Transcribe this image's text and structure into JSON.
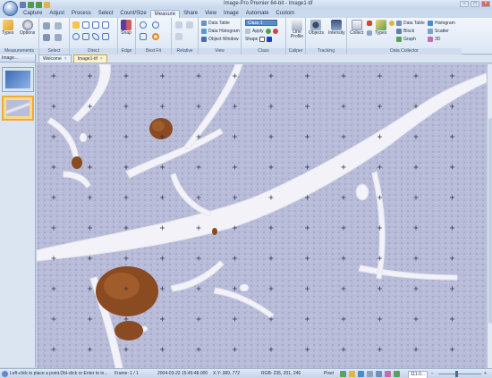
{
  "window": {
    "title": "Image-Pro Premier 64-bit - Image1-tif"
  },
  "menu": {
    "tabs": [
      "Capture",
      "Adjust",
      "Process",
      "Select",
      "Count/Size",
      "Measure",
      "Share",
      "View",
      "Image",
      "Automate",
      "Custom"
    ],
    "active": "Measure"
  },
  "ribbon": {
    "groups": {
      "measurements": "Measurements",
      "select": "Select",
      "direct": "Direct",
      "edge": "Edge",
      "best_fit": "Best Fit",
      "relative": "Relative",
      "view": "View",
      "class": "Class",
      "caliper": "Caliper",
      "tracking": "Tracking",
      "data_collector": "Data Collector"
    },
    "buttons": {
      "types": "Types",
      "options": "Options",
      "snap": "Snap",
      "data_table": "Data Table",
      "data_histogram": "Data Histogram",
      "object_window": "Object Window",
      "apply": "Apply",
      "shape": "Shape",
      "line_profile": "Line Profile",
      "objects": "Objects",
      "intensity": "Intensity",
      "collect": "Collect",
      "dc_types": "Types",
      "dc_data_table": "Data Table",
      "block": "Block",
      "graph": "Graph",
      "histogram": "Histogram",
      "scatter": "Scatter",
      "three_d": "3D"
    },
    "class_combo": "Class 1"
  },
  "left_panel": {
    "header": "Image..."
  },
  "doc_tabs": [
    {
      "label": "Welcome"
    },
    {
      "label": "Image1-tif"
    }
  ],
  "status": {
    "hint": "Left-click to place a point.Dbl-click or Enter to in...",
    "frame": "Frame: 1 / 1",
    "timestamp": "2004-03-22 15:45:48.000",
    "coords": "X,Y: 389, 772",
    "rgb": "RGB:  235,  201,  246",
    "unit": "Pixel",
    "zoom": "111.0..."
  },
  "colors": {
    "tissue": "#b9bdd9",
    "islet": "#8a4a22",
    "duct": "#f4f3f8",
    "accent_active_tab": "#f0a93b"
  }
}
